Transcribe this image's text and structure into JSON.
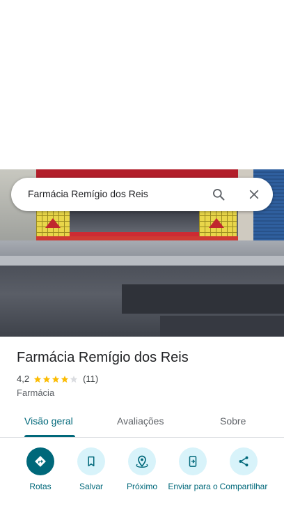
{
  "search": {
    "query": "Farmácia Remígio dos Reis",
    "search_icon": "search-icon",
    "close_icon": "close-icon"
  },
  "place": {
    "name": "Farmácia Remígio dos Reis",
    "rating": "4,2",
    "rating_value": 4.2,
    "stars_max": 5,
    "review_count": "(11)",
    "category": "Farmácia"
  },
  "tabs": [
    {
      "label": "Visão geral",
      "active": true
    },
    {
      "label": "Avaliações",
      "active": false
    },
    {
      "label": "Sobre",
      "active": false
    }
  ],
  "actions": [
    {
      "label": "Rotas",
      "icon": "directions-icon"
    },
    {
      "label": "Salvar",
      "icon": "bookmark-icon"
    },
    {
      "label": "Próximo",
      "icon": "nearby-icon"
    },
    {
      "label": "Enviar para o",
      "icon": "send-to-phone-icon"
    },
    {
      "label": "Compartilhar",
      "icon": "share-icon"
    }
  ],
  "colors": {
    "accent": "#00687a",
    "chip_bg": "#d8f3fa",
    "star": "#fbbc04",
    "star_empty": "#dadce0"
  }
}
